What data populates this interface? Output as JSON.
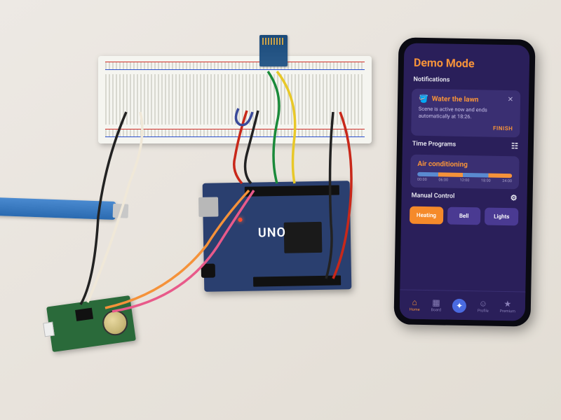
{
  "hardware": {
    "microcontroller_label": "UNO",
    "usb_cable_color": "#3a7ac0",
    "modules": [
      "Arduino UNO",
      "HC-05 Bluetooth",
      "DS1307 RTC",
      "Breadboard"
    ]
  },
  "phone": {
    "header": "Demo Mode",
    "sections": {
      "notifications": {
        "label": "Notifications",
        "card": {
          "title": "Water the lawn",
          "body": "Scene is active now and ends automatically at 18:26.",
          "action": "FINISH"
        }
      },
      "time_programs": {
        "label": "Time Programs",
        "card_title": "Air conditioning",
        "ticks": [
          "00:00",
          "06:00",
          "12:00",
          "18:00",
          "24:00"
        ]
      },
      "manual": {
        "label": "Manual Control",
        "buttons": [
          {
            "label": "Heating",
            "active": true
          },
          {
            "label": "Bell",
            "active": false
          },
          {
            "label": "Lights",
            "active": false
          }
        ]
      }
    },
    "nav": [
      {
        "label": "Home",
        "icon": "⌂",
        "state": "active"
      },
      {
        "label": "Board",
        "icon": "▦",
        "state": ""
      },
      {
        "label": "",
        "icon": "✦",
        "state": "highlight"
      },
      {
        "label": "Profile",
        "icon": "☺",
        "state": ""
      },
      {
        "label": "Premium",
        "icon": "★",
        "state": ""
      }
    ]
  }
}
